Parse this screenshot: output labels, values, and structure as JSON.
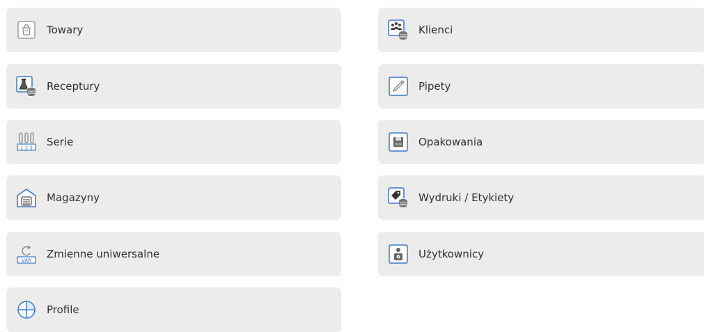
{
  "tiles_left": [
    {
      "label": "Towary",
      "icon": "shopping-bag-icon"
    },
    {
      "label": "Receptury",
      "icon": "flask-database-icon"
    },
    {
      "label": "Serie",
      "icon": "test-tubes-series-icon"
    },
    {
      "label": "Magazyny",
      "icon": "warehouse-icon"
    },
    {
      "label": "Zmienne uniwersalne",
      "icon": "var-variable-icon"
    },
    {
      "label": "Profile",
      "icon": "profile-circle-icon"
    }
  ],
  "tiles_right": [
    {
      "label": "Klienci",
      "icon": "clients-database-icon"
    },
    {
      "label": "Pipety",
      "icon": "pipette-icon"
    },
    {
      "label": "Opakowania",
      "icon": "packaging-icon"
    },
    {
      "label": "Wydruki / Etykiety",
      "icon": "label-tag-database-icon"
    },
    {
      "label": "Użytkownicy",
      "icon": "user-icon"
    }
  ],
  "colors": {
    "tile_bg": "#ececec",
    "icon_blue": "#3a78c8",
    "icon_gray": "#6e6e6e",
    "text": "#303030"
  }
}
